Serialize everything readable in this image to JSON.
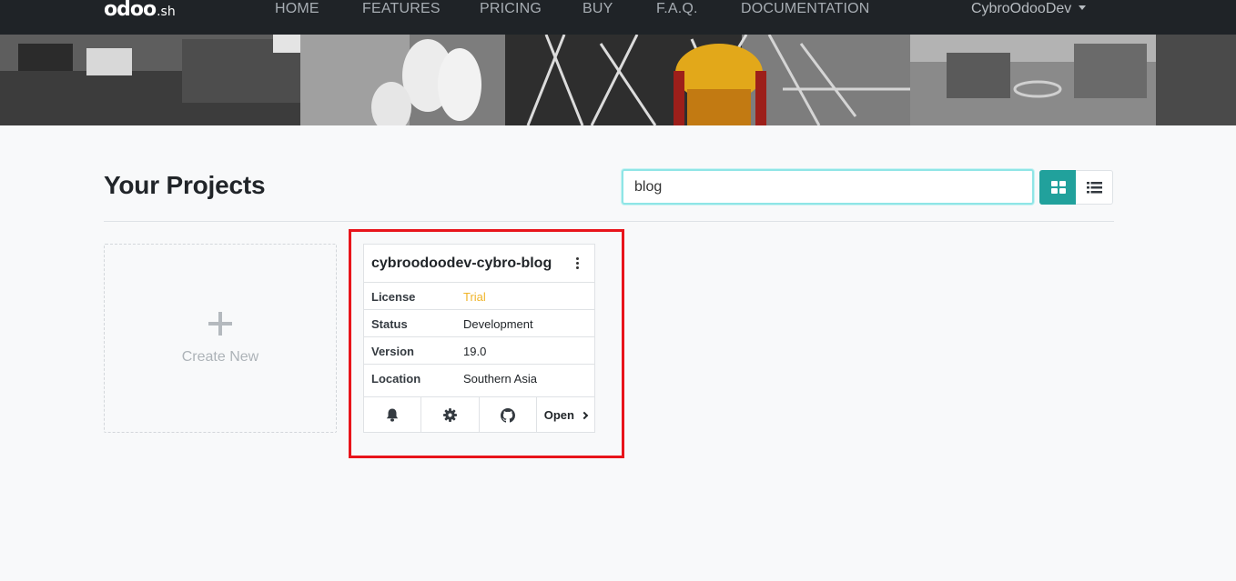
{
  "brand": {
    "logo_main": "odoo",
    "logo_suffix": ".sh"
  },
  "nav": {
    "items": [
      {
        "label": "HOME"
      },
      {
        "label": "FEATURES"
      },
      {
        "label": "PRICING"
      },
      {
        "label": "BUY"
      },
      {
        "label": "F.A.Q."
      },
      {
        "label": "DOCUMENTATION"
      }
    ],
    "user": "CybroOdooDev"
  },
  "main": {
    "title": "Your Projects",
    "search": {
      "value": "blog",
      "placeholder": ""
    },
    "view_toggle": {
      "active": "grid"
    },
    "create_new": {
      "icon": "plus-icon",
      "label": "Create New"
    }
  },
  "project": {
    "name": "cybroodoodev-cybro-blog",
    "fields": [
      {
        "key": "License",
        "value": "Trial"
      },
      {
        "key": "Status",
        "value": "Development"
      },
      {
        "key": "Version",
        "value": "19.0"
      },
      {
        "key": "Location",
        "value": "Southern Asia"
      }
    ],
    "actions": {
      "open_label": "Open",
      "icons": [
        "bell-icon",
        "gear-icon",
        "github-icon",
        "chevron-right-icon"
      ]
    }
  },
  "colors": {
    "navbar": "#1f2327",
    "accent": "#21a19c",
    "trial": "#f0b429",
    "highlight": "#e8141b"
  }
}
